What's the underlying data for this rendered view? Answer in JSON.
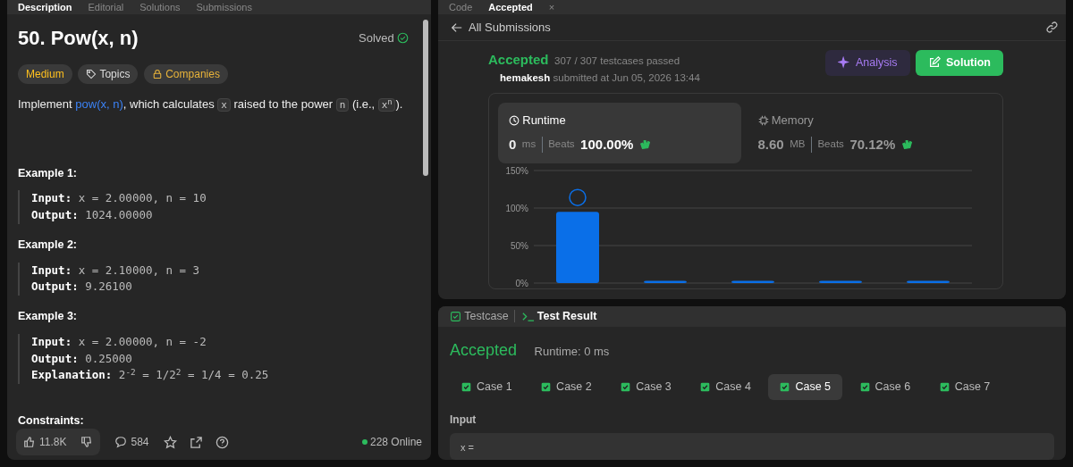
{
  "left_panel": {
    "tabs": [
      {
        "label": "Description",
        "selected": true
      },
      {
        "label": "Editorial",
        "selected": false
      },
      {
        "label": "Solutions",
        "selected": false
      },
      {
        "label": "Submissions",
        "selected": false
      }
    ],
    "title": "50. Pow(x, n)",
    "status": "Solved",
    "tags": [
      {
        "label": "Medium",
        "kind": "difficulty"
      },
      {
        "label": "Topics",
        "kind": "topics"
      },
      {
        "label": "Companies",
        "kind": "companies"
      }
    ],
    "statement": [
      {
        "kind": "text",
        "text": "Implement "
      },
      {
        "kind": "link",
        "text": "pow(x, n)"
      },
      {
        "kind": "text",
        "text": ", which calculates "
      },
      {
        "kind": "code",
        "text": "x"
      },
      {
        "kind": "text",
        "text": " raised to the power "
      },
      {
        "kind": "code",
        "text": "n"
      },
      {
        "kind": "text",
        "text": " (i.e., "
      },
      {
        "kind": "code",
        "text": "x$^{n}$"
      },
      {
        "kind": "text",
        "text": ")."
      }
    ],
    "examples": [
      {
        "heading": "Example 1:",
        "lines": [
          {
            "label": "Input:",
            "value": "x = 2.00000, n = 10"
          },
          {
            "label": "Output:",
            "value": "1024.00000"
          }
        ]
      },
      {
        "heading": "Example 2:",
        "lines": [
          {
            "label": "Input:",
            "value": "x = 2.10000, n = 3"
          },
          {
            "label": "Output:",
            "value": "9.26100"
          }
        ]
      },
      {
        "heading": "Example 3:",
        "lines": [
          {
            "label": "Input:",
            "value": "x = 2.00000, n = -2"
          },
          {
            "label": "Output:",
            "value": "0.25000"
          },
          {
            "label": "Explanation:",
            "value": "2$^{-2}$ = 1/2$^{2}$ = 1/4 = 0.25"
          }
        ]
      }
    ],
    "constraints_heading": "Constraints:",
    "likes": "11.8K",
    "comments": "584",
    "online": "228 Online"
  },
  "right_panel": {
    "tabs": [
      {
        "label": "Code",
        "selected": false
      },
      {
        "label": "Accepted",
        "selected": true,
        "close": "×"
      }
    ],
    "back_link": "All Submissions",
    "result": "Accepted",
    "testcases": "307 / 307 testcases passed",
    "user": "hemakesh",
    "submitted": "submitted at Jun 05, 2026 13:44",
    "buttons": [
      {
        "label": "Analysis",
        "kind": "analysis"
      },
      {
        "label": "Solution",
        "kind": "solution"
      }
    ],
    "stats": [
      {
        "title": "Runtime",
        "kind": "runtime",
        "value": "0",
        "unit": "ms",
        "beats_label": "Beats",
        "beats": "100.00%",
        "selected": true
      },
      {
        "title": "Memory",
        "kind": "memory",
        "value": "8.60",
        "unit": "MB",
        "beats_label": "Beats",
        "beats": "70.12%",
        "selected": false
      }
    ],
    "chart_data": {
      "type": "bar",
      "yticks": [
        {
          "value": 0,
          "label": "0%"
        },
        {
          "value": 50,
          "label": "50%"
        },
        {
          "value": 100,
          "label": "100%"
        },
        {
          "value": 150,
          "label": "150%"
        }
      ],
      "ylim": [
        0,
        150
      ],
      "series": [
        {
          "color": "#0a6fe8",
          "values": [
            95,
            3,
            3,
            3,
            3
          ]
        }
      ]
    }
  },
  "bottom_panel": {
    "tabs": [
      {
        "label": "Testcase",
        "selected": false
      },
      {
        "label": "Test Result",
        "selected": true
      }
    ],
    "result": "Accepted",
    "runtime": "Runtime: 0 ms",
    "cases": [
      {
        "label": "Case 1",
        "passed": true,
        "selected": false
      },
      {
        "label": "Case 2",
        "passed": true,
        "selected": false
      },
      {
        "label": "Case 3",
        "passed": true,
        "selected": false
      },
      {
        "label": "Case 4",
        "passed": true,
        "selected": false
      },
      {
        "label": "Case 5",
        "passed": true,
        "selected": true
      },
      {
        "label": "Case 6",
        "passed": true,
        "selected": false
      },
      {
        "label": "Case 7",
        "passed": true,
        "selected": false
      }
    ],
    "input_label": "Input",
    "input_value": "x ="
  }
}
